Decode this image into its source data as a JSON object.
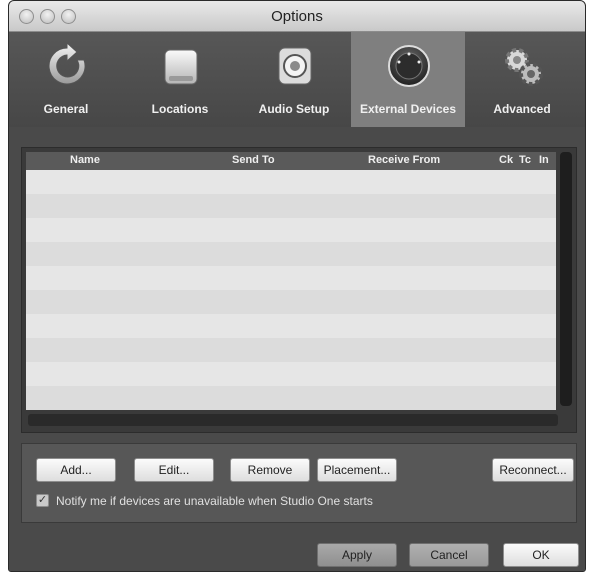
{
  "window": {
    "title": "Options"
  },
  "tabs": [
    {
      "label": "General",
      "icon": "refresh-icon"
    },
    {
      "label": "Locations",
      "icon": "drive-icon"
    },
    {
      "label": "Audio Setup",
      "icon": "speaker-icon"
    },
    {
      "label": "External Devices",
      "icon": "knob-icon",
      "selected": true
    },
    {
      "label": "Advanced",
      "icon": "gears-icon"
    }
  ],
  "table": {
    "columns": [
      "Name",
      "Send To",
      "Receive From",
      "Ck",
      "Tc",
      "In"
    ],
    "rows": []
  },
  "device_buttons": {
    "add": "Add...",
    "edit": "Edit...",
    "remove": "Remove",
    "placement": "Placement...",
    "reconnect": "Reconnect..."
  },
  "notify": {
    "checked": true,
    "label": "Notify me if devices are unavailable when Studio One starts"
  },
  "footer": {
    "apply": "Apply",
    "cancel": "Cancel",
    "ok": "OK"
  },
  "colors": {
    "selected_tab": "#7f7f7f",
    "window_bg": "#4a4a4a"
  }
}
